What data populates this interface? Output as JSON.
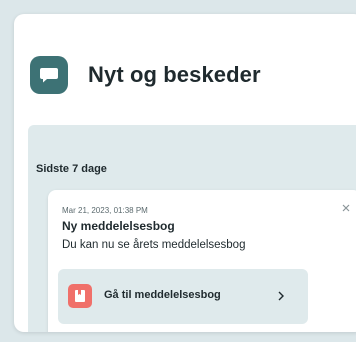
{
  "header": {
    "title": "Nyt og beskeder",
    "icon": "chat-bubble-icon"
  },
  "section": {
    "title": "Sidste 7 dage"
  },
  "notification": {
    "timestamp": "Mar 21, 2023, 01:38 PM",
    "title": "Ny meddelelsesbog",
    "body": "Du kan nu se årets meddelelsesbog",
    "close_icon": "close-icon",
    "action": {
      "label": "Gå til meddelelsesbog",
      "icon": "book-icon",
      "chevron": "chevron-right-icon"
    }
  },
  "colors": {
    "background": "#dce7ea",
    "accent": "#3d7275",
    "panel": "#dfeaec",
    "action_icon": "#f0706a"
  }
}
